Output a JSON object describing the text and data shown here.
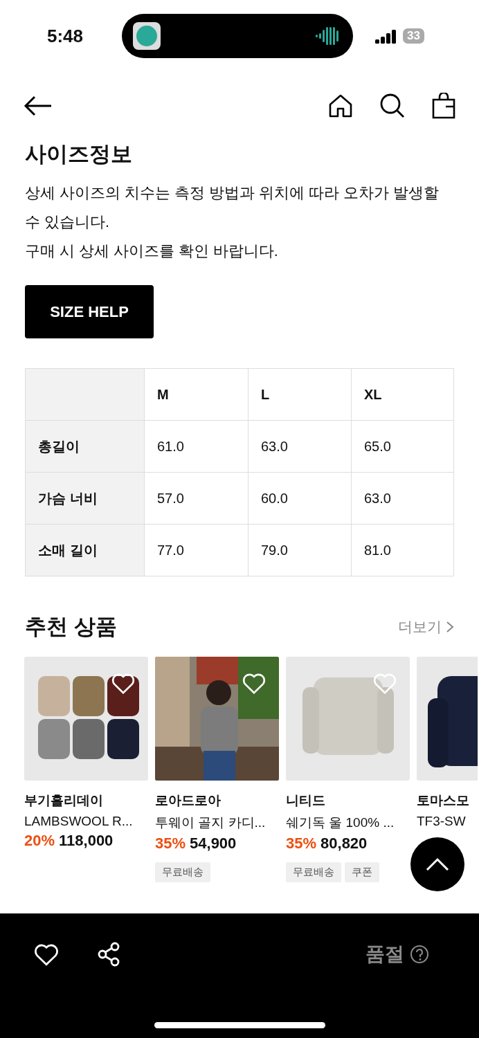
{
  "status_bar": {
    "time": "5:48",
    "battery": "33"
  },
  "title": "사이즈정보",
  "notice": [
    "상세 사이즈의 치수는 측정 방법과 위치에 따라 오차가 발생할 수 있습니다.",
    "구매 시 상세 사이즈를 확인 바랍니다."
  ],
  "size_help_button": "SIZE HELP",
  "size_table": {
    "columns": [
      "M",
      "L",
      "XL"
    ],
    "rows": [
      {
        "label": "총길이",
        "values": [
          "61.0",
          "63.0",
          "65.0"
        ]
      },
      {
        "label": "가슴 너비",
        "values": [
          "57.0",
          "60.0",
          "63.0"
        ]
      },
      {
        "label": "소매 길이",
        "values": [
          "77.0",
          "79.0",
          "81.0"
        ]
      }
    ]
  },
  "recommended": {
    "title": "추천 상품",
    "more": "더보기",
    "products": [
      {
        "kind": "picture",
        "brand": "부기홀리데이",
        "name": "LAMBSWOOL R...",
        "discount": "20%",
        "price": "118,000"
      },
      {
        "kind": "picture",
        "brand": "로아드로아",
        "name": "투웨이 골지 카디...",
        "discount": "35%",
        "price": "54,900",
        "tags": [
          "무료배송"
        ]
      },
      {
        "kind": "picture",
        "brand": "니티드",
        "name": "쉐기독 울 100% ...",
        "discount": "35%",
        "price": "80,820",
        "tags": [
          "무료배송",
          "쿠폰"
        ]
      },
      {
        "kind": "picture",
        "brand": "토마스모",
        "name": "TF3-SW"
      }
    ]
  },
  "bottom_bar": {
    "status": "품절"
  }
}
